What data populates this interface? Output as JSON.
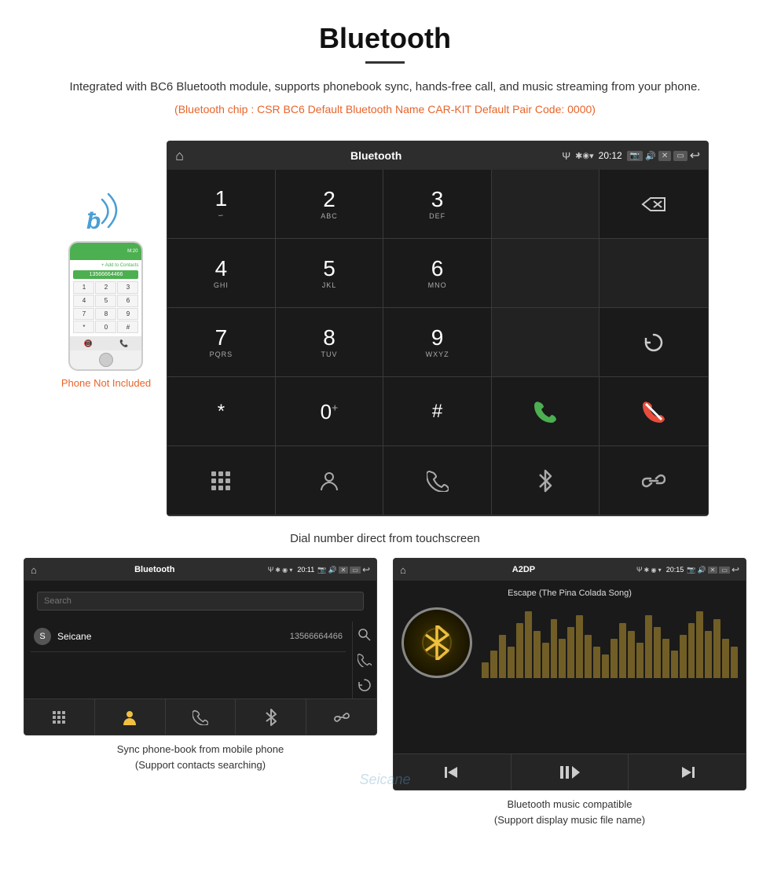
{
  "header": {
    "title": "Bluetooth",
    "description": "Integrated with BC6 Bluetooth module, supports phonebook sync, hands-free call, and music streaming from your phone.",
    "specs": "(Bluetooth chip : CSR BC6   Default Bluetooth Name CAR-KIT    Default Pair Code: 0000)"
  },
  "phone_label": "Phone Not Included",
  "main_screen": {
    "status_bar": {
      "title": "Bluetooth",
      "time": "20:12",
      "usb_symbol": "Ψ"
    },
    "dialpad": {
      "keys": [
        {
          "number": "1",
          "letters": "∽∽"
        },
        {
          "number": "2",
          "letters": "ABC"
        },
        {
          "number": "3",
          "letters": "DEF"
        },
        {
          "number": "4",
          "letters": "GHI"
        },
        {
          "number": "5",
          "letters": "JKL"
        },
        {
          "number": "6",
          "letters": "MNO"
        },
        {
          "number": "7",
          "letters": "PQRS"
        },
        {
          "number": "8",
          "letters": "TUV"
        },
        {
          "number": "9",
          "letters": "WXYZ"
        },
        {
          "number": "*",
          "letters": ""
        },
        {
          "number": "0",
          "letters": "+"
        },
        {
          "number": "#",
          "letters": ""
        }
      ]
    }
  },
  "main_caption": "Dial number direct from touchscreen",
  "bottom_left": {
    "status_title": "Bluetooth",
    "search_placeholder": "Search",
    "contact": {
      "letter": "S",
      "name": "Seicane",
      "number": "13566664466"
    },
    "caption_line1": "Sync phone-book from mobile phone",
    "caption_line2": "(Support contacts searching)"
  },
  "bottom_right": {
    "status_title": "A2DP",
    "song_title": "Escape (The Pina Colada Song)",
    "caption_line1": "Bluetooth music compatible",
    "caption_line2": "(Support display music file name)"
  },
  "watermark": "Seicane",
  "icons": {
    "home": "⌂",
    "back": "↩",
    "bluetooth": "✱",
    "gps": "◉",
    "signal": "▾",
    "camera": "📷",
    "volume": "🔊",
    "close_x": "✕",
    "screen": "▭",
    "backspace": "⌫",
    "refresh": "↻",
    "call_green": "📞",
    "call_red": "📞",
    "dialpad": "⊞",
    "contact": "👤",
    "phone": "📞",
    "bt_symbol": "⚡",
    "link": "🔗",
    "search": "🔍",
    "prev": "⏮",
    "play_pause": "⏯",
    "next": "⏭"
  },
  "viz_bars": [
    20,
    35,
    55,
    40,
    70,
    85,
    60,
    45,
    75,
    50,
    65,
    80,
    55,
    40,
    30,
    50,
    70,
    60,
    45,
    80,
    65,
    50,
    35,
    55,
    70,
    85,
    60,
    75,
    50,
    40
  ]
}
